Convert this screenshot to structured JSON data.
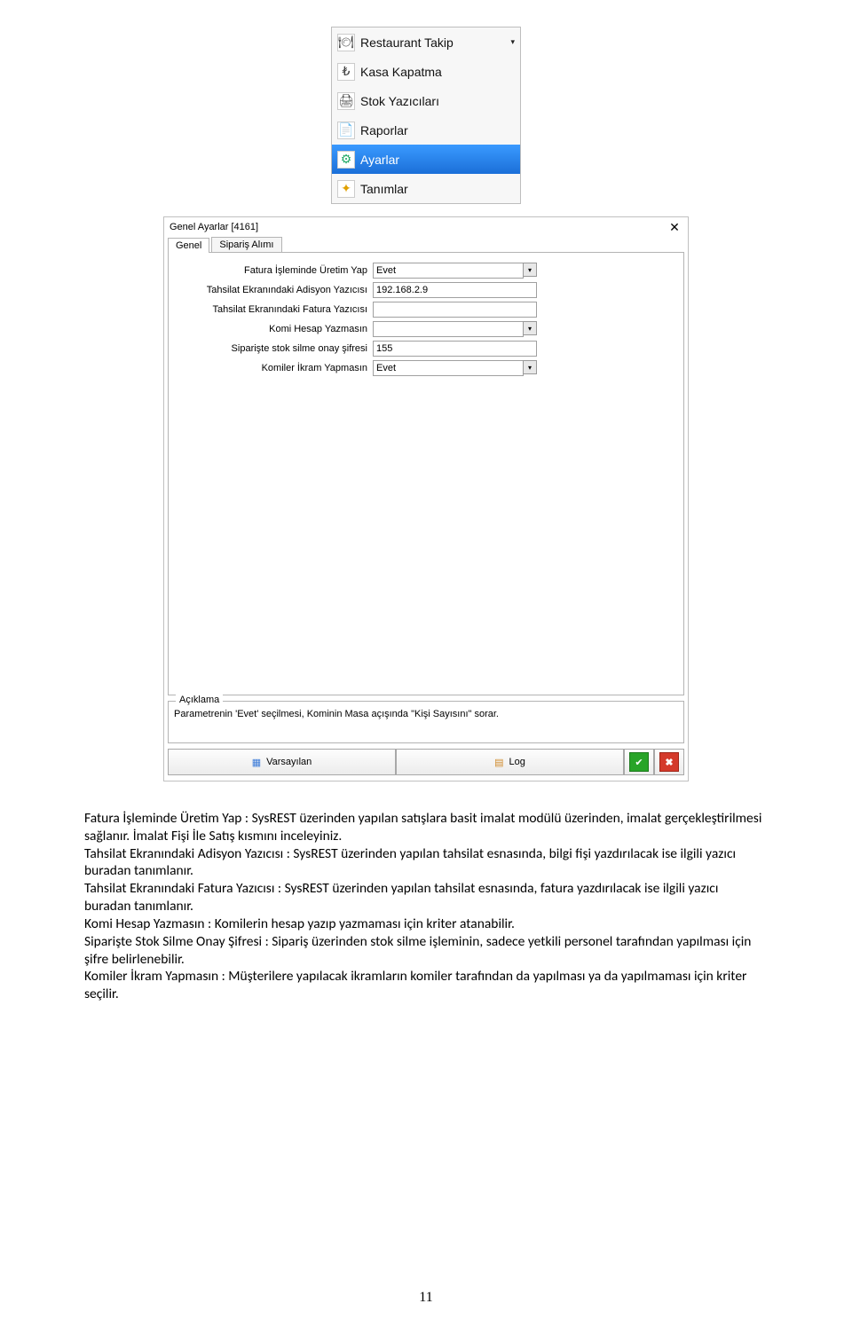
{
  "menu": {
    "items": [
      {
        "label": "Restaurant Takip",
        "has_dropdown": true,
        "icon": "restaurant-icon"
      },
      {
        "label": "Kasa Kapatma",
        "icon": "cash-icon"
      },
      {
        "label": "Stok Yazıcıları",
        "icon": "printer-icon"
      },
      {
        "label": "Raporlar",
        "icon": "reports-icon"
      },
      {
        "label": "Ayarlar",
        "icon": "settings-icon",
        "selected": true
      },
      {
        "label": "Tanımlar",
        "icon": "definitions-icon"
      }
    ]
  },
  "dialog": {
    "title": "Genel Ayarlar  [4161]",
    "tabs": [
      "Genel",
      "Sipariş Alımı"
    ],
    "active_tab": "Genel",
    "fields": [
      {
        "label": "Fatura İşleminde Üretim Yap",
        "value": "Evet",
        "type": "combo"
      },
      {
        "label": "Tahsilat Ekranındaki Adisyon Yazıcısı",
        "value": "192.168.2.9",
        "type": "text"
      },
      {
        "label": "Tahsilat Ekranındaki Fatura Yazıcısı",
        "value": "",
        "type": "text"
      },
      {
        "label": "Komi Hesap Yazmasın",
        "value": "",
        "type": "combo"
      },
      {
        "label": "Siparişte stok silme onay şifresi",
        "value": "155",
        "type": "text"
      },
      {
        "label": "Komiler İkram Yapmasın",
        "value": "Evet",
        "type": "combo"
      }
    ],
    "aciklama_legend": "Açıklama",
    "aciklama_text": "Parametrenin 'Evet' seçilmesi, Kominin Masa açışında \"Kişi Sayısını\" sorar.",
    "varsayilan": "Varsayılan",
    "log": "Log"
  },
  "body": {
    "p1a": "Fatura İşleminde Üretim Yap :",
    "p1b": " SysREST üzerinden yapılan satışlara basit imalat modülü üzerinden, imalat gerçekleştirilmesi sağlanır. İmalat Fişi İle Satış kısmını inceleyiniz.",
    "p2a": "Tahsilat Ekranındaki Adisyon Yazıcısı :",
    "p2b": " SysREST üzerinden yapılan tahsilat esnasında, bilgi fişi yazdırılacak ise ilgili yazıcı buradan tanımlanır.",
    "p3a": "Tahsilat Ekranındaki Fatura Yazıcısı :",
    "p3b": " SysREST üzerinden yapılan tahsilat esnasında, fatura yazdırılacak ise ilgili yazıcı buradan tanımlanır.",
    "p4a": "Komi Hesap Yazmasın :",
    "p4b": " Komilerin hesap yazıp yazmaması için kriter atanabilir.",
    "p5a": "Siparişte Stok Silme Onay Şifresi :",
    "p5b": " Sipariş üzerinden stok silme işleminin, sadece yetkili personel tarafından yapılması için şifre belirlenebilir.",
    "p6a": "Komiler İkram Yapmasın :",
    "p6b": " Müşterilere yapılacak ikramların komiler tarafından da yapılması ya da yapılmaması için kriter seçilir."
  },
  "page_number": "11"
}
